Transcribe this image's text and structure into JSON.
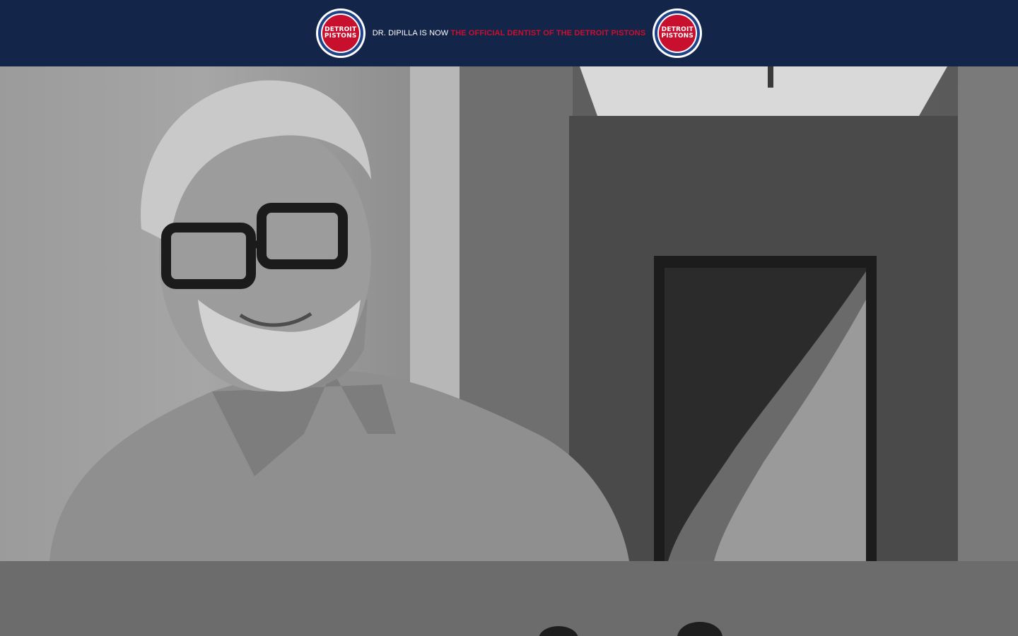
{
  "banner": {
    "prefix": "DR. DIPILLA IS NOW",
    "highlight": "THE OFFICIAL DENTIST OF THE DETROIT PISTONS",
    "logo_left": {
      "line1": "DETROIT",
      "line2": "PISTONS"
    },
    "logo_right": {
      "line1": "DETROIT",
      "line2": "PISTONS"
    },
    "colors": {
      "background": "#14254a",
      "accent": "#c8102e",
      "logo_blue": "#1d428a"
    }
  },
  "hero": {
    "image": "portrait of smiling man with gray hair, beard and dark glasses in a hallway, grayscale"
  },
  "lower_section": {
    "image": "grayscale photo, tops of two heads"
  }
}
